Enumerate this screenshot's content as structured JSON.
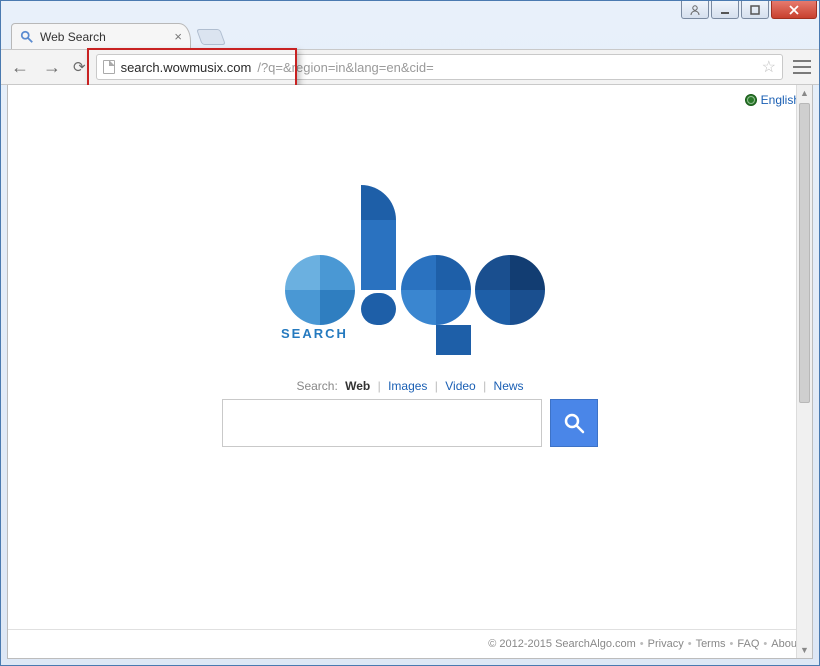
{
  "window": {
    "tab_title": "Web Search"
  },
  "url": {
    "host": "search.wowmusix.com",
    "rest": "/?q=&region=in&lang=en&cid="
  },
  "lang_link": "English",
  "logo": {
    "subtext": "SEARCH"
  },
  "search_tabs": {
    "label": "Search:",
    "items": [
      "Web",
      "Images",
      "Video",
      "News"
    ],
    "active_index": 0
  },
  "search": {
    "value": "",
    "placeholder": ""
  },
  "footer": {
    "copyright": "© 2012-2015 SearchAlgo.com",
    "links": [
      "Privacy",
      "Terms",
      "FAQ",
      "About"
    ]
  }
}
